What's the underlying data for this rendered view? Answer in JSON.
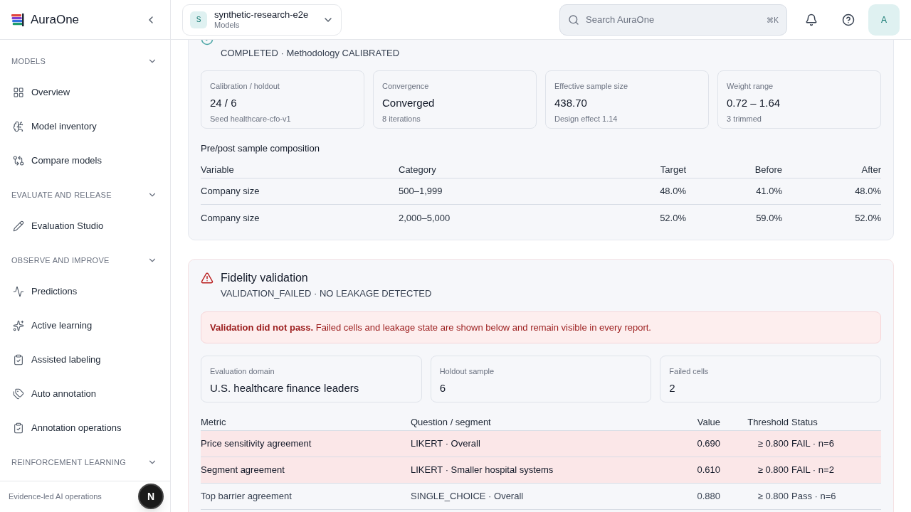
{
  "brand": {
    "name": "AuraOne"
  },
  "project": {
    "initial": "S",
    "name": "synthetic-research-e2e",
    "subtitle": "Models"
  },
  "search": {
    "placeholder": "Search AuraOne",
    "shortcut": "⌘K"
  },
  "user": {
    "initial": "A"
  },
  "sidebar": {
    "sections": [
      {
        "title": "MODELS",
        "expanded": true,
        "items": [
          {
            "label": "Overview",
            "kind": "grid"
          },
          {
            "label": "Model inventory",
            "kind": "brain"
          },
          {
            "label": "Compare models",
            "kind": "compare"
          }
        ]
      },
      {
        "title": "EVALUATE AND RELEASE",
        "expanded": true,
        "items": [
          {
            "label": "Evaluation Studio",
            "kind": "pencil"
          }
        ]
      },
      {
        "title": "OBSERVE AND IMPROVE",
        "expanded": true,
        "items": [
          {
            "label": "Predictions",
            "kind": "pulse"
          },
          {
            "label": "Active learning",
            "kind": "sparkles"
          },
          {
            "label": "Assisted labeling",
            "kind": "clipboard"
          },
          {
            "label": "Auto annotation",
            "kind": "tags"
          },
          {
            "label": "Annotation operations",
            "kind": "clipboard"
          }
        ]
      },
      {
        "title": "REINFORCEMENT LEARNING",
        "expanded": true
      }
    ],
    "footer": "Evidence-led AI operations",
    "dev_badge": "N"
  },
  "calibration": {
    "status": "COMPLETED · Methodology CALIBRATED",
    "stats": [
      {
        "label": "Calibration / holdout",
        "value": "24 / 6",
        "note": "Seed healthcare-cfo-v1"
      },
      {
        "label": "Convergence",
        "value": "Converged",
        "note": "8 iterations"
      },
      {
        "label": "Effective sample size",
        "value": "438.70",
        "note": "Design effect 1.14"
      },
      {
        "label": "Weight range",
        "value": "0.72 – 1.64",
        "note": "3 trimmed"
      }
    ],
    "table_title": "Pre/post sample composition",
    "columns": [
      "Variable",
      "Category",
      "Target",
      "Before",
      "After"
    ],
    "rows": [
      [
        "Company size",
        "500–1,999",
        "48.0%",
        "41.0%",
        "48.0%"
      ],
      [
        "Company size",
        "2,000–5,000",
        "52.0%",
        "59.0%",
        "52.0%"
      ]
    ]
  },
  "fidelity": {
    "title": "Fidelity validation",
    "status": "VALIDATION_FAILED · NO LEAKAGE DETECTED",
    "alert": {
      "strong": "Validation did not pass.",
      "text": "Failed cells and leakage state are shown below and remain visible in every report."
    },
    "stats": [
      {
        "label": "Evaluation domain",
        "value": "U.S. healthcare finance leaders"
      },
      {
        "label": "Holdout sample",
        "value": "6"
      },
      {
        "label": "Failed cells",
        "value": "2"
      }
    ],
    "columns": [
      "Metric",
      "Question / segment",
      "Value",
      "Threshold",
      "Status"
    ],
    "rows": [
      {
        "cells": [
          "Price sensitivity agreement",
          "LIKERT · Overall",
          "0.690",
          "≥ 0.800",
          "FAIL · n=6"
        ],
        "failed": true
      },
      {
        "cells": [
          "Segment agreement",
          "LIKERT · Smaller hospital systems",
          "0.610",
          "≥ 0.800",
          "FAIL · n=2"
        ],
        "failed": true
      },
      {
        "cells": [
          "Top barrier agreement",
          "SINGLE_CHOICE · Overall",
          "0.880",
          "≥ 0.800",
          "Pass · n=6"
        ],
        "failed": false
      }
    ]
  }
}
